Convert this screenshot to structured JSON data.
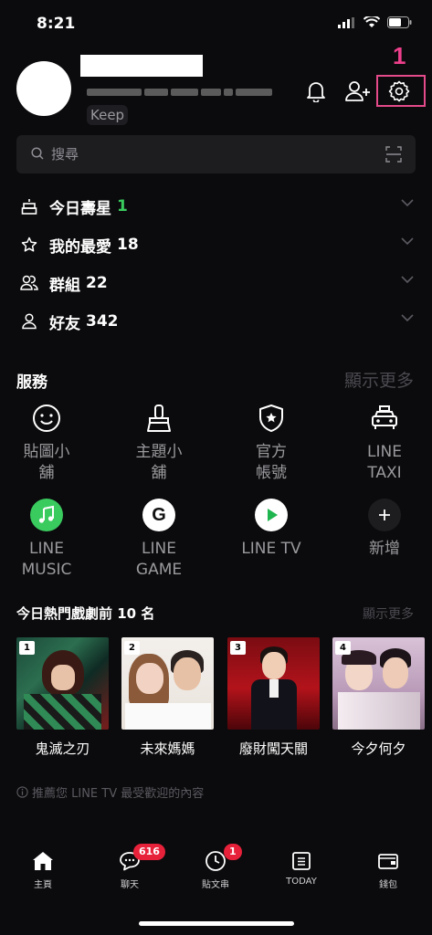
{
  "status_bar": {
    "time": "8:21"
  },
  "profile": {
    "keep_label": "Keep"
  },
  "annotation": {
    "label": "1"
  },
  "search": {
    "placeholder": "搜尋"
  },
  "friends_list": [
    {
      "label": "今日壽星",
      "count": "1",
      "count_color": "#3acb5f",
      "icon": "cake-icon"
    },
    {
      "label": "我的最愛",
      "count": "18",
      "count_color": "#ffffff",
      "icon": "star-icon"
    },
    {
      "label": "群組",
      "count": "22",
      "count_color": "#ffffff",
      "icon": "group-icon"
    },
    {
      "label": "好友",
      "count": "342",
      "count_color": "#ffffff",
      "icon": "person-icon"
    }
  ],
  "services": {
    "title": "服務",
    "more": "顯示更多",
    "items": [
      {
        "label_l1": "貼圖小",
        "label_l2": "舖",
        "icon": "smiley-icon"
      },
      {
        "label_l1": "主題小",
        "label_l2": "舖",
        "icon": "brush-icon"
      },
      {
        "label_l1": "官方",
        "label_l2": "帳號",
        "icon": "shield-star-icon"
      },
      {
        "label_l1": "LINE",
        "label_l2": "TAXI",
        "icon": "taxi-icon"
      },
      {
        "label_l1": "LINE",
        "label_l2": "MUSIC",
        "icon": "music-icon"
      },
      {
        "label_l1": "LINE",
        "label_l2": "GAME",
        "icon": "game-icon"
      },
      {
        "label_l1": "LINE TV",
        "label_l2": "",
        "icon": "play-icon"
      },
      {
        "label_l1": "新增",
        "label_l2": "",
        "icon": "plus-icon"
      }
    ]
  },
  "dramas": {
    "title": "今日熱門戲劇前 10 名",
    "more": "顯示更多",
    "items": [
      {
        "rank": "1",
        "title": "鬼滅之刃"
      },
      {
        "rank": "2",
        "title": "未來媽媽"
      },
      {
        "rank": "3",
        "title": "廢財闖天關"
      },
      {
        "rank": "4",
        "title": "今夕何夕"
      }
    ]
  },
  "recommendation": {
    "text": "推薦您 LINE TV 最受歡迎的內容"
  },
  "tabbar": [
    {
      "label": "主頁",
      "icon": "home-icon",
      "badge": ""
    },
    {
      "label": "聊天",
      "icon": "chat-icon",
      "badge": "616"
    },
    {
      "label": "貼文串",
      "icon": "clock-icon",
      "badge": "1"
    },
    {
      "label": "TODAY",
      "icon": "news-icon",
      "badge": ""
    },
    {
      "label": "錢包",
      "icon": "wallet-icon",
      "badge": ""
    }
  ],
  "colors": {
    "accent_green": "#3acb5f",
    "badge_red": "#e8213a",
    "annotation_pink": "#e54a8a"
  }
}
